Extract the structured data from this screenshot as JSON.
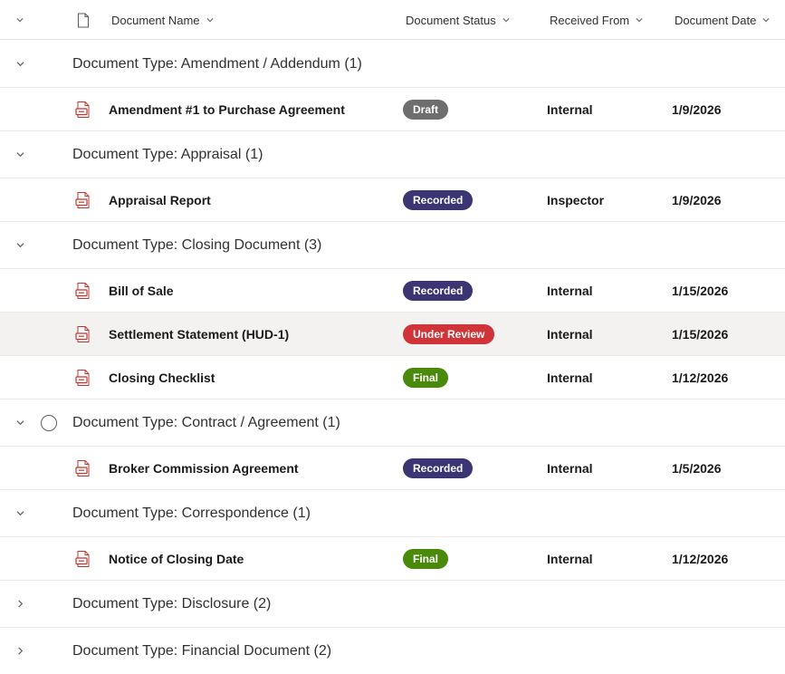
{
  "header": {
    "col_name": "Document Name",
    "col_status": "Document Status",
    "col_from": "Received From",
    "col_date": "Document Date"
  },
  "colors": {
    "Draft": "#6e6e6e",
    "Recorded": "#3b3574",
    "Under Review": "#d13438",
    "Final": "#4a8a0b",
    "file_icon": "#c4362c"
  },
  "groups": [
    {
      "label": "Document Type: Amendment / Addendum (1)",
      "expanded": true,
      "items": [
        {
          "name": "Amendment #1 to Purchase Agreement",
          "status": "Draft",
          "from": "Internal",
          "date": "1/9/2026"
        }
      ]
    },
    {
      "label": "Document Type: Appraisal (1)",
      "expanded": true,
      "items": [
        {
          "name": "Appraisal Report",
          "status": "Recorded",
          "from": "Inspector",
          "date": "1/9/2026"
        }
      ]
    },
    {
      "label": "Document Type: Closing Document (3)",
      "expanded": true,
      "items": [
        {
          "name": "Bill of Sale",
          "status": "Recorded",
          "from": "Internal",
          "date": "1/15/2026"
        },
        {
          "name": "Settlement Statement (HUD-1)",
          "status": "Under Review",
          "from": "Internal",
          "date": "1/15/2026",
          "hover": true
        },
        {
          "name": "Closing Checklist",
          "status": "Final",
          "from": "Internal",
          "date": "1/12/2026"
        }
      ]
    },
    {
      "label": "Document Type: Contract / Agreement (1)",
      "expanded": true,
      "select_circle": true,
      "items": [
        {
          "name": "Broker Commission Agreement",
          "status": "Recorded",
          "from": "Internal",
          "date": "1/5/2026"
        }
      ]
    },
    {
      "label": "Document Type: Correspondence (1)",
      "expanded": true,
      "items": [
        {
          "name": "Notice of Closing Date",
          "status": "Final",
          "from": "Internal",
          "date": "1/12/2026"
        }
      ]
    },
    {
      "label": "Document Type: Disclosure (2)",
      "expanded": false,
      "items": []
    },
    {
      "label": "Document Type: Financial Document (2)",
      "expanded": false,
      "items": []
    }
  ]
}
